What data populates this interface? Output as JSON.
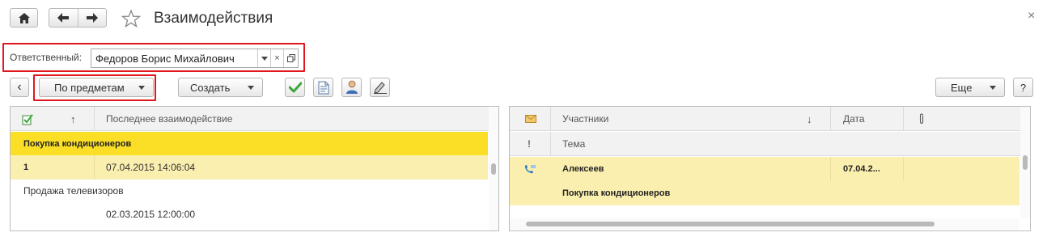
{
  "window": {
    "title": "Взаимодействия",
    "close_glyph": "×"
  },
  "responsible": {
    "label": "Ответственный:",
    "value": "Федоров Борис Михайлович"
  },
  "toolbar": {
    "back_glyph": "‹",
    "grouping_label": "По предметам",
    "create_label": "Создать",
    "more_label": "Еще",
    "help_label": "?"
  },
  "left_table": {
    "sort_glyph": "↑",
    "columns": [
      "Последнее взаимодействие"
    ],
    "rows": [
      {
        "group": "Покупка кондиционеров",
        "count": "1",
        "last": "07.04.2015 14:06:04"
      },
      {
        "group": "Продажа телевизоров",
        "count": "",
        "last": "02.03.2015 12:00:00"
      }
    ]
  },
  "right_table": {
    "columns": {
      "participants": "Участники",
      "sort_glyph": "↓",
      "date": "Дата",
      "topic": "Тема",
      "important_glyph": "!"
    },
    "rows": [
      {
        "participant": "Алексеев",
        "date": "07.04.2...",
        "topic": "Покупка кондиционеров"
      }
    ]
  },
  "colors": {
    "group_row": "#fbdf27",
    "selected_row": "#fbefb0",
    "highlight_frame": "#e0171d",
    "ok_green": "#3aa83a"
  },
  "icons": [
    "home-icon",
    "arrow-left-icon",
    "arrow-right-icon",
    "star-icon",
    "dropdown-icon",
    "clear-icon",
    "open-icon",
    "check-icon",
    "document-icon",
    "person-icon",
    "edit-icon",
    "interaction-icon",
    "envelope-icon",
    "attachment-icon",
    "phone-call-icon"
  ]
}
